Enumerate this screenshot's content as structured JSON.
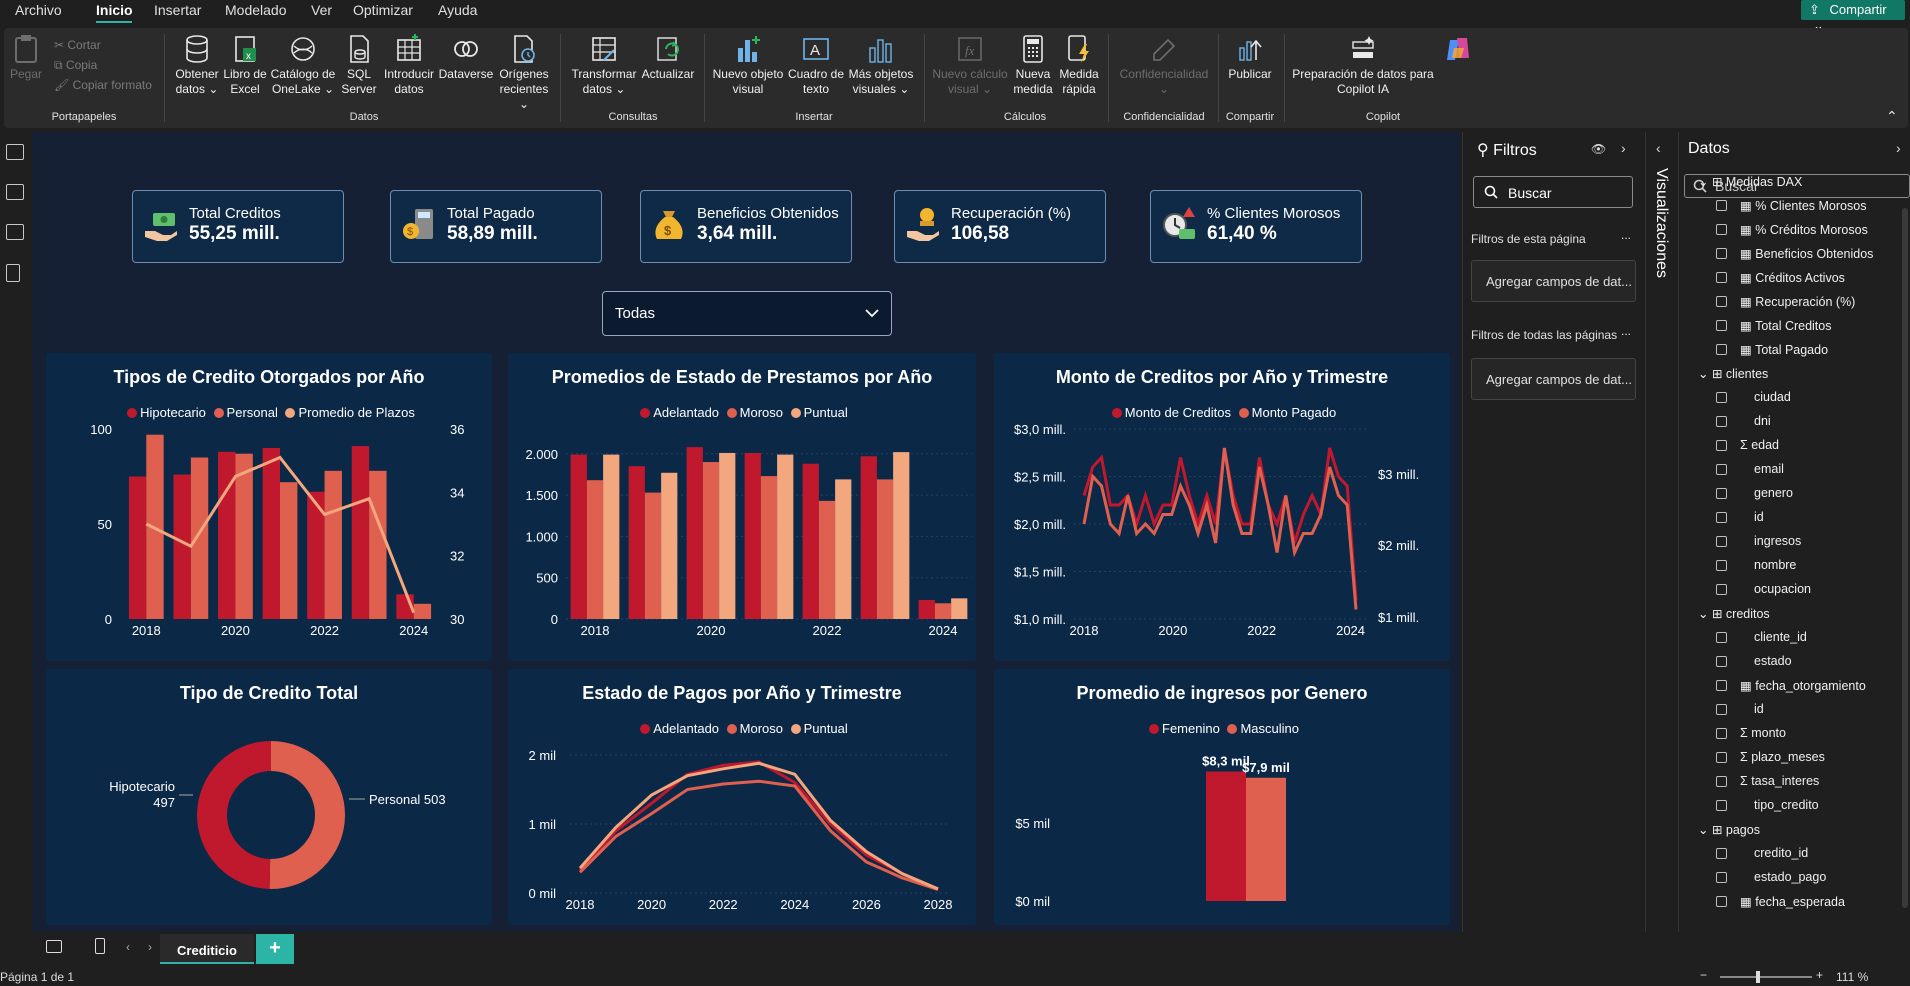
{
  "menu": {
    "items": [
      "Archivo",
      "Inicio",
      "Insertar",
      "Modelado",
      "Ver",
      "Optimizar",
      "Ayuda"
    ],
    "share": "Compartir"
  },
  "ribbon": {
    "pegar": "Pegar",
    "cortar": "Cortar",
    "copia": "Copia",
    "copiar_formato": "Copiar formato",
    "obtener": "Obtener datos ⌄",
    "excel": "Libro de Excel",
    "onelake": "Catálogo de OneLake ⌄",
    "sql": "SQL Server",
    "introducir": "Introducir datos",
    "dataverse": "Dataverse",
    "origenes": "Orígenes recientes ⌄",
    "transformar": "Transformar datos ⌄",
    "actualizar": "Actualizar",
    "nuevo_visual": "Nuevo objeto visual",
    "cuadro_texto": "Cuadro de texto",
    "mas_visuales": "Más objetos visuales ⌄",
    "nuevo_calculo": "Nuevo cálculo visual ⌄",
    "nueva_medida": "Nueva medida",
    "medida_rapida": "Medida rápida",
    "confidencialidad": "Confidencialidad ⌄",
    "publicar": "Publicar",
    "copilot_prep": "Preparación de datos para Copilot IA",
    "groups": {
      "portapapeles": "Portapapeles",
      "datos": "Datos",
      "consultas": "Consultas",
      "insertar": "Insertar",
      "calculos": "Cálculos",
      "confidencialidad": "Confidencialidad",
      "compartir": "Compartir",
      "copilot": "Copilot"
    }
  },
  "kpis": [
    {
      "label": "Total Creditos",
      "value": "55,25 mill."
    },
    {
      "label": "Total Pagado",
      "value": "58,89 mill."
    },
    {
      "label": "Beneficios Obtenidos",
      "value": "3,64 mill."
    },
    {
      "label": "Recuperación (%)",
      "value": "106,58"
    },
    {
      "label": "% Clientes Morosos",
      "value": "61,40 %"
    }
  ],
  "slicer": {
    "value": "Todas"
  },
  "colors": {
    "dark_red": "#c0192e",
    "red": "#e0604f",
    "peach": "#f2a77e"
  },
  "chart_data": [
    {
      "type": "bar",
      "title": "Tipos de Credito Otorgados por Año",
      "categories": [
        "2018",
        "2019",
        "2020",
        "2021",
        "2022",
        "2023",
        "2024"
      ],
      "x_ticks": [
        "2018",
        "2020",
        "2022",
        "2024"
      ],
      "series": [
        {
          "name": "Hipotecario",
          "values": [
            75,
            76,
            88,
            90,
            67,
            91,
            13
          ]
        },
        {
          "name": "Personal",
          "values": [
            97,
            85,
            87,
            72,
            78,
            78,
            8
          ]
        },
        {
          "name": "Promedio de Plazos",
          "axis": "secondary",
          "values": [
            33.0,
            32.3,
            34.5,
            35.1,
            33.3,
            33.8,
            30.2
          ]
        }
      ],
      "ylim": [
        0,
        100
      ],
      "y_ticks": [
        "0",
        "50",
        "100"
      ],
      "y2lim": [
        30,
        36
      ],
      "y2_ticks": [
        "30",
        "32",
        "34",
        "36"
      ]
    },
    {
      "type": "bar",
      "title": "Promedios de Estado de Prestamos por Año",
      "categories": [
        "2018",
        "2019",
        "2020",
        "2021",
        "2022",
        "2023",
        "2024"
      ],
      "x_ticks": [
        "2018",
        "2020",
        "2022",
        "2024"
      ],
      "series": [
        {
          "name": "Adelantado",
          "values": [
            1990,
            1850,
            2080,
            2010,
            1880,
            1970,
            230
          ]
        },
        {
          "name": "Moroso",
          "values": [
            1680,
            1530,
            1900,
            1730,
            1430,
            1690,
            190
          ]
        },
        {
          "name": "Puntual",
          "values": [
            1990,
            1770,
            2010,
            1990,
            1690,
            2020,
            250
          ]
        }
      ],
      "ylim": [
        0,
        2300
      ],
      "y_ticks": [
        "0",
        "500",
        "1.000",
        "1.500",
        "2.000"
      ]
    },
    {
      "type": "line",
      "title": "Monto de Creditos por Año y Trimestre",
      "x_ticks": [
        "2018",
        "2020",
        "2022",
        "2024"
      ],
      "series": [
        {
          "name": "Monto de Creditos",
          "values": [
            2.3,
            2.6,
            2.7,
            2.2,
            2.2,
            2.3,
            2.0,
            2.3,
            2.0,
            2.2,
            2.2,
            2.7,
            2.3,
            2.0,
            2.3,
            2.0,
            2.8,
            2.3,
            2.0,
            2.0,
            2.7,
            2.2,
            2.0,
            2.3,
            1.8,
            2.1,
            2.3,
            2.1,
            2.8,
            2.5,
            2.4,
            1.2
          ]
        },
        {
          "name": "Monto Pagado",
          "values": [
            2.0,
            2.5,
            2.4,
            2.0,
            1.9,
            2.3,
            1.9,
            2.0,
            1.9,
            2.1,
            2.1,
            2.4,
            2.2,
            1.9,
            2.2,
            1.8,
            2.8,
            2.2,
            1.9,
            1.9,
            2.6,
            2.2,
            1.7,
            2.3,
            1.7,
            1.9,
            1.9,
            2.1,
            2.6,
            2.3,
            2.2,
            1.1
          ]
        }
      ],
      "ylim": [
        1.0,
        3.0
      ],
      "y_ticks": [
        "$1,0 mill.",
        "$1,5 mill.",
        "$2,0 mill.",
        "$2,5 mill.",
        "$3,0 mill."
      ],
      "y2_ticks": [
        "$1 mill.",
        "$2 mill.",
        "$3 mill."
      ]
    },
    {
      "type": "pie",
      "title": "Tipo de Credito Total",
      "slices": [
        {
          "name": "Hipotecario",
          "value": 497,
          "label": "497"
        },
        {
          "name": "Personal",
          "value": 503,
          "label": "Personal 503"
        }
      ]
    },
    {
      "type": "line",
      "title": "Estado de Pagos por Año y Trimestre",
      "x": [
        2018,
        2019,
        2020,
        2021,
        2022,
        2023,
        2024,
        2025,
        2026,
        2027,
        2028
      ],
      "x_ticks": [
        "2018",
        "2020",
        "2022",
        "2024",
        "2026",
        "2028"
      ],
      "series": [
        {
          "name": "Adelantado",
          "values": [
            0.33,
            0.9,
            1.3,
            1.72,
            1.85,
            1.9,
            1.6,
            1.0,
            0.55,
            0.28,
            0.06
          ]
        },
        {
          "name": "Moroso",
          "values": [
            0.3,
            0.82,
            1.15,
            1.5,
            1.58,
            1.62,
            1.55,
            0.9,
            0.45,
            0.22,
            0.05
          ]
        },
        {
          "name": "Puntual",
          "values": [
            0.36,
            0.95,
            1.42,
            1.7,
            1.8,
            1.88,
            1.72,
            1.05,
            0.6,
            0.28,
            0.06
          ]
        }
      ],
      "ylim": [
        0,
        2
      ],
      "y_ticks": [
        "0 mil",
        "1 mil",
        "2 mil"
      ]
    },
    {
      "type": "bar",
      "title": "Promedio de ingresos por Genero",
      "categories": [
        "Femenino",
        "Masculino"
      ],
      "series": [
        {
          "name": "Femenino",
          "values": [
            8.3
          ],
          "label": "$8,3 mil"
        },
        {
          "name": "Masculino",
          "values": [
            7.9
          ],
          "label": "$7,9 mil"
        }
      ],
      "ylim": [
        0,
        10
      ],
      "y_ticks": [
        "$0 mil",
        "$5 mil"
      ]
    }
  ],
  "filters": {
    "title": "Filtros",
    "search": "Buscar",
    "this_page": "Filtros de esta página",
    "all_pages": "Filtros de todas las páginas",
    "add": "Agregar campos de dat...",
    "more": "..."
  },
  "viz": {
    "title": "Visualizaciones"
  },
  "datos": {
    "title": "Datos",
    "search": "Buscar",
    "tables": [
      {
        "name": "Medidas DAX",
        "fields": [
          "% Clientes Morosos",
          "% Créditos Morosos",
          "Beneficios Obtenidos",
          "Créditos Activos",
          "Recuperación (%)",
          "Total Creditos",
          "Total Pagado"
        ]
      },
      {
        "name": "clientes",
        "fields": [
          "ciudad",
          "dni",
          "edad",
          "email",
          "genero",
          "id",
          "ingresos",
          "nombre",
          "ocupacion"
        ]
      },
      {
        "name": "creditos",
        "fields": [
          "cliente_id",
          "estado",
          "fecha_otorgamiento",
          "id",
          "monto",
          "plazo_meses",
          "tasa_interes",
          "tipo_credito"
        ]
      },
      {
        "name": "pagos",
        "fields": [
          "credito_id",
          "estado_pago",
          "fecha_esperada"
        ]
      }
    ]
  },
  "page_tab": "Crediticio",
  "status": {
    "page": "Página 1 de 1",
    "zoom": "111 %"
  }
}
